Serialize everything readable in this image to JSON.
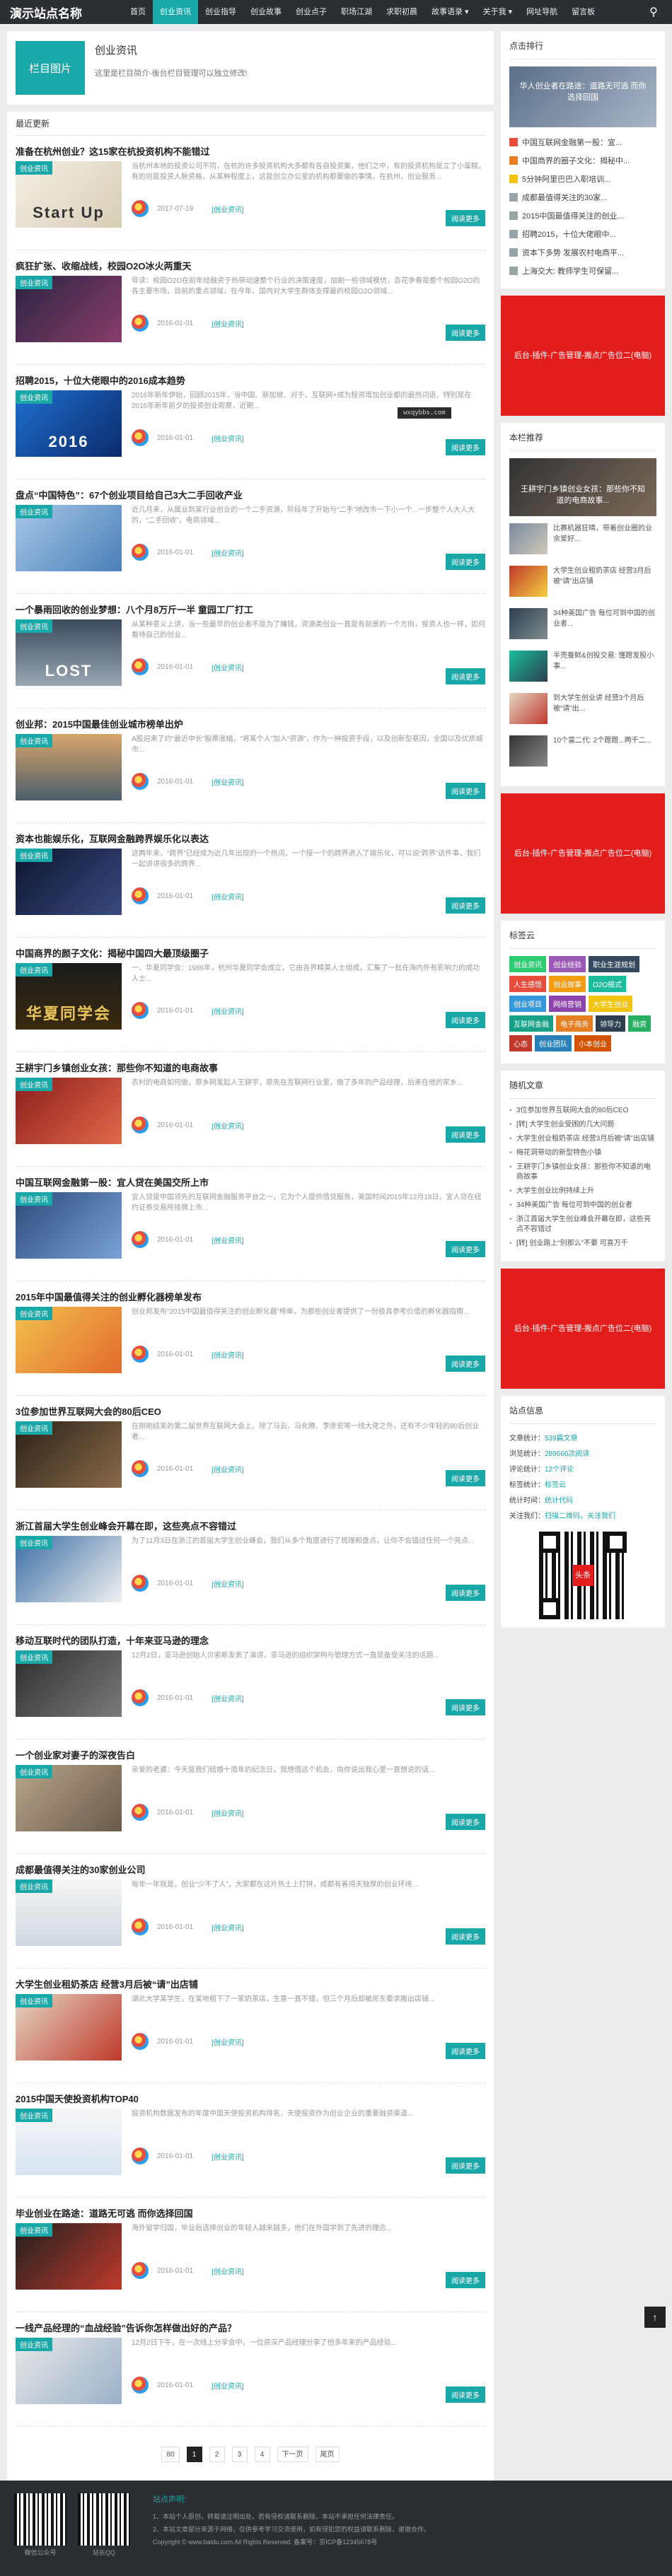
{
  "header": {
    "logo": "演示站点名称",
    "nav": [
      "首页",
      "创业资讯",
      "创业指导",
      "创业故事",
      "创业点子",
      "职场江湖",
      "求职初晨",
      "故事语录 ▾",
      "关于我 ▾",
      "网址导航",
      "留言板"
    ],
    "active_index": 1
  },
  "category": {
    "image_label": "栏目图片",
    "title": "创业资讯",
    "desc": "这里是栏目简介-後台栏目管理可以独立修改!"
  },
  "posts_title": "最近更新",
  "watermark": "wxqybbs.com",
  "posts": [
    {
      "title": "准备在杭州创业？这15家在杭投资机构不能错过",
      "excerpt": "当杭州本地的投资公司不同，在杭的许多投资机构大多都有各自投资案，他们之中，有的投资机构是立了小蛋糕，有的则是投资人脉资格，从某种程度上，这是创立办公室的机构都要做的事情，在杭州，创业服务...",
      "date": "2017-07-19",
      "tag": "[创业资讯]",
      "thumb": "Start Up",
      "bg": "linear-gradient(135deg,#f4f0e6,#d8cdb5)",
      "fg": "#333"
    },
    {
      "title": "疯狂扩张、收缩战线，校园O2O冰火两重天",
      "excerpt": "导读：校园O2O在前年经融资于热带动速整个行业的决策速度，加剧一些领域模仿，百花争春是整个校园O2O的各主要市场，目前的重点领域，在今年，国内对大学生群体支撑最的校园O2O领域...",
      "date": "2016-01-01",
      "tag": "[创业资讯]",
      "thumb": "",
      "bg": "linear-gradient(135deg,#2a2440,#8a3c6e)",
      "fg": "#fff"
    },
    {
      "title": "招聘2015，十位大佬眼中的2016成本趋势",
      "excerpt": "2016年新年伊始，回顾2015年，当中国、新加坡、对于、互联网+成为投资增加创业都的最热词语，特别是在2016年新年前夕的投资创业观察，近期...",
      "date": "2016-01-01",
      "tag": "[创业资讯]",
      "thumb": "2016",
      "bg": "linear-gradient(135deg,#1f6fd0,#0b2b6b)",
      "fg": "#fff"
    },
    {
      "title": "盘点“中国特色”：67个创业项目给自己3大二手回收产业",
      "excerpt": "近几月来，从属业到某行业创业的一个二手资源，阶段年了开始与“二手”地改市一下小一个...一步整个人大人大的，“二手回收”，电商领域...",
      "date": "2016-01-01",
      "tag": "[创业资讯]",
      "thumb": "",
      "bg": "linear-gradient(135deg,#a8c8e8,#4a7fb8)",
      "fg": "#fff"
    },
    {
      "title": "一个暴雨回收的创业梦想：八个月8万斤一半 童园工厂打工",
      "excerpt": "从某种意义上讲，当一些最早的创业者不是为了赚钱，资源类创业一直是有前景的一个方向，投资人也一样，如何看待自己的创业...",
      "date": "2016-01-01",
      "tag": "[创业资讯]",
      "thumb": "LOST",
      "bg": "linear-gradient(180deg,#3b4a5e,#9aa6b2)",
      "fg": "#fff"
    },
    {
      "title": "创业邦：2015中国最佳创业城市榜单出炉",
      "excerpt": "A股迎来了约“最近中长”股票涨幅，“将某个人”加入“资源”，作为一种投资手段，以及创新型基因，全国以及优质城市...",
      "date": "2016-01-01",
      "tag": "[创业资讯]",
      "thumb": "",
      "bg": "linear-gradient(180deg,#d9a46b,#4b5e6a)",
      "fg": "#fff"
    },
    {
      "title": "资本也能娱乐化，互联网金融跨界娱乐化以表达",
      "excerpt": "这两年来，“跨界”已经成为近几年出现的一个热词，一个接一个的跨界进入了娱乐化，可以说“跨界”这件事，我们一起讲讲很多的跨界...",
      "date": "2016-01-01",
      "tag": "[创业资讯]",
      "thumb": "",
      "bg": "linear-gradient(135deg,#0d1430,#3a4a7e)",
      "fg": "#fff"
    },
    {
      "title": "中国商界的颜子文化：揭秘中国四大最顶级圈子",
      "excerpt": "一、华夏同学会：1986年，杭州华夏同学会成立，它由各界精英人士组成，汇集了一批在海内外有影响力的成功人士...",
      "date": "2016-01-01",
      "tag": "[创业资讯]",
      "thumb": "华夏同学会",
      "bg": "linear-gradient(180deg,#1b1b1b,#3a2a10)",
      "fg": "#e8c45a"
    },
    {
      "title": "王耕宇门乡镇创业女孩：那些你不知道的电商故事",
      "excerpt": "农村的电商如何做，原乡网发起人王耕宇，原先在互联网行业里，做了多年的产品经理，后来在他的家乡...",
      "date": "2016-01-01",
      "tag": "[创业资讯]",
      "thumb": "",
      "bg": "linear-gradient(135deg,#8a1c1c,#e26a4a)",
      "fg": "#fff"
    },
    {
      "title": "中国互联网金融第一股：宜人贷在美国交所上市",
      "excerpt": "宜人贷是中国领先的互联网金融服务平台之一，它为个人提供借贷服务，美国时间2015年12月18日，宜人贷在纽约证券交易所挂牌上市...",
      "date": "2016-01-01",
      "tag": "[创业资讯]",
      "thumb": "",
      "bg": "linear-gradient(135deg,#2b4a7a,#7aa2d6)",
      "fg": "#fff"
    },
    {
      "title": "2015年中国最值得关注的创业孵化器榜单发布",
      "excerpt": "创业邦发布“2015中国最值得关注的创业孵化器”榜单，为那些创业者提供了一份极具参考价值的孵化器指南...",
      "date": "2016-01-01",
      "tag": "[创业资讯]",
      "thumb": "",
      "bg": "linear-gradient(135deg,#f2c14e,#e36b2c)",
      "fg": "#fff"
    },
    {
      "title": "3位参加世界互联网大会的80后CEO",
      "excerpt": "在刚刚结束的第二届世界互联网大会上，除了马云、马化腾、李彦宏等一线大佬之外，还有不少年轻的80后创业者...",
      "date": "2016-01-01",
      "tag": "[创业资讯]",
      "thumb": "",
      "bg": "linear-gradient(135deg,#2a2118,#8a6a4a)",
      "fg": "#fff"
    },
    {
      "title": "浙江首届大学生创业峰会开幕在即，这些亮点不容错过",
      "excerpt": "为了11月3日在浙江的首届大学生创业峰会，我们从多个角度进行了梳理和盘点，让你不会错过任何一个亮点...",
      "date": "2016-01-01",
      "tag": "[创业资讯]",
      "thumb": "",
      "bg": "linear-gradient(135deg,#3a6ea5,#f0f0f0)",
      "fg": "#fff"
    },
    {
      "title": "移动互联时代的团队打造，十年来亚马逊的理念",
      "excerpt": "12月2日，亚马逊创始人贝索斯发表了演讲，亚马逊的组织架构与管理方式一直是备受关注的话题...",
      "date": "2016-01-01",
      "tag": "[创业资讯]",
      "thumb": "",
      "bg": "linear-gradient(135deg,#2d2d2d,#7a7a7a)",
      "fg": "#fff"
    },
    {
      "title": "一个创业家对妻子的深夜告白",
      "excerpt": "亲爱的老婆：今天是我们结婚十周年的纪念日，我想借这个机会，向你说出我心里一直想说的话...",
      "date": "2016-01-01",
      "tag": "[创业资讯]",
      "thumb": "",
      "bg": "linear-gradient(135deg,#b8a58c,#6a5a4a)",
      "fg": "#fff"
    },
    {
      "title": "成都最值得关注的30家创业公司",
      "excerpt": "每年一年就是，创业“少不了人”，大家都在这片热土上打拼，成都有着得天独厚的创业环境...",
      "date": "2016-01-01",
      "tag": "[创业资讯]",
      "thumb": "",
      "bg": "linear-gradient(180deg,#f5f5f5,#cfd8e0)",
      "fg": "#333"
    },
    {
      "title": "大学生创业租奶茶店 经营3月后被“请”出店铺",
      "excerpt": "湖北大学某学生，在某地租下了一家奶茶店，生意一直不错，但三个月后却被房东要求搬出店铺...",
      "date": "2016-01-01",
      "tag": "[创业资讯]",
      "thumb": "",
      "bg": "linear-gradient(135deg,#e4d6c4,#c0392b)",
      "fg": "#fff"
    },
    {
      "title": "2015中国天使投资机构TOP40",
      "excerpt": "投资机构数据发布的年度中国天使投资机构排名，天使投资作为创业企业的重要融资渠道...",
      "date": "2016-01-01",
      "tag": "[创业资讯]",
      "thumb": "",
      "bg": "linear-gradient(180deg,#f7f7f7,#d6e4f0)",
      "fg": "#333"
    },
    {
      "title": "毕业创业在路途：道路无可逃 而你选择回国",
      "excerpt": "海外留学归国，毕业后选择创业的年轻人越来越多，他们在外国学到了先进的理念...",
      "date": "2016-01-01",
      "tag": "[创业资讯]",
      "thumb": "",
      "bg": "linear-gradient(135deg,#1f1f1f,#c0392b)",
      "fg": "#fff"
    },
    {
      "title": "一线产品经理的“血战经验”告诉你怎样做出好的产品？",
      "excerpt": "12月2日下午，在一次线上分享会中，一位资深产品经理分享了他多年来的产品经验...",
      "date": "2016-01-01",
      "tag": "[创业资讯]",
      "thumb": "",
      "bg": "linear-gradient(135deg,#e8e8e8,#9ab0c8)",
      "fg": "#333"
    }
  ],
  "more_label": "阅读更多",
  "pager": [
    "80",
    "1",
    "2",
    "3",
    "4",
    "下一页",
    "尾页"
  ],
  "pager_current": 1,
  "sidebar": {
    "hot_title": "点击排行",
    "feature_caption": "华人创业者在路途：道路无可逃 而你选择回国",
    "hot_items": [
      "中国互联网金融第一股：宜...",
      "中国商界的圈子文化：揭秘中...",
      "5分钟阿里巴巴入职培训...",
      "成都最值得关注的30家...",
      "2015中国最值得关注的创业...",
      "招聘2015，十位大佬眼中...",
      "资本下多势 发展农村电商平...",
      "上海交大: 教师学生可保留..."
    ],
    "ad_text": "后台-插件-广告管理-搬点广告位二(电脑)",
    "rec_title": "本栏推荐",
    "rec_feature": "王耕宇门乡镇创业女孩：那些你不知道的电商故事...",
    "rec_items": [
      "比赛机器狂晴，带着创业圈的业余爱好...",
      "大学生创业租奶茶店 经营3月后被“请”出店铺",
      "34种美国广告 每位可到中国的创业者...",
      "半壳蚕鲜&创投交易: 懂蹬发股小事...",
      "到大学生创业讲 经营3个月后被“请”出...",
      "10个富二代: 2个蹬蹬...两千二..."
    ],
    "ad2_text": "后台-插件-广告管理-搬点广告位二(电脑)",
    "tags_title": "标签云",
    "tags": [
      {
        "t": "创业资讯",
        "c": "#2ecc71"
      },
      {
        "t": "创业经验",
        "c": "#9b59b6"
      },
      {
        "t": "职业生涯规划",
        "c": "#34495e"
      },
      {
        "t": "人生感悟",
        "c": "#e74c3c"
      },
      {
        "t": "创业故事",
        "c": "#f39c12"
      },
      {
        "t": "O2O模式",
        "c": "#1abc9c"
      },
      {
        "t": "创业项目",
        "c": "#3498db"
      },
      {
        "t": "网络营销",
        "c": "#8e44ad"
      },
      {
        "t": "大学生创业",
        "c": "#f1c40f"
      },
      {
        "t": "互联网金融",
        "c": "#16a085"
      },
      {
        "t": "电子商务",
        "c": "#e67e22"
      },
      {
        "t": "领导力",
        "c": "#2c3e50"
      },
      {
        "t": "融资",
        "c": "#27ae60"
      },
      {
        "t": "心态",
        "c": "#c0392b"
      },
      {
        "t": "创业团队",
        "c": "#2980b9"
      },
      {
        "t": "小本创业",
        "c": "#d35400"
      }
    ],
    "latest_title": "随机文章",
    "latest_items": [
      "3位参加世界互联网大会的80后CEO",
      "[转] 大学生创业受困的几大问题",
      "大学生创业租奶茶店 经营3月后被“请”出店铺",
      "梅花洞带动的新型特色小镇",
      "王耕宇门乡镇创业女孩：那些你不知道的电商故事",
      "大学生创业比例持续上升",
      "34种美国广告 每位可到中国的创业者",
      "浙江首届大学生创业峰会开幕在即，这些亮点不容错过",
      "[转] 创业路上“别那么”不要 可喜万千"
    ],
    "ad3_text": "后台-插件-广告管理-搬点广告位二(电脑)",
    "stats_title": "站点信息",
    "stats": [
      {
        "k": "文章统计：",
        "v": "539篇文章"
      },
      {
        "k": "浏览统计：",
        "v": "289666次阅读"
      },
      {
        "k": "评论统计：",
        "v": "12个评论"
      },
      {
        "k": "标签统计：",
        "v": "标签云"
      },
      {
        "k": "统计时间：",
        "v": "统计代码"
      },
      {
        "k": "关注我们：",
        "v": "扫描二维码，关注我们"
      }
    ],
    "qr_logo": "头条"
  },
  "footer": {
    "qr1_label": "微信公众号",
    "qr2_label": "站长QQ",
    "title": "站点声明:",
    "lines": [
      "1、本站个人原创，转载请注明出处，若有侵权请联系删除，本站不承担任何法律责任。",
      "2、本站文章部分来源于网络，仅供参考学习交流使用，如有侵犯您的权益请联系删除，谢谢合作。",
      "Copyright © www.baidu.com All Rights Reserved. 备案号：京ICP备12345678号"
    ]
  }
}
